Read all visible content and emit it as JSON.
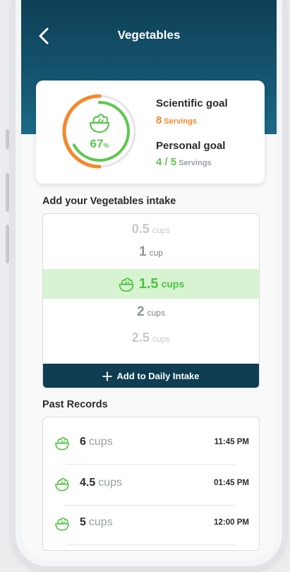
{
  "header": {
    "title": "Vegetables"
  },
  "goal_card": {
    "progress": 0.67,
    "percent_value": "67",
    "percent_sign": "%",
    "scientific_label": "Scientific goal",
    "scientific_value": "8",
    "scientific_unit": "Servings",
    "personal_label": "Personal goal",
    "personal_value": "4 / 5",
    "personal_unit": "Servings"
  },
  "intake": {
    "title": "Add your Vegetables intake",
    "options": [
      {
        "num": "0.5",
        "unit": "cups"
      },
      {
        "num": "1",
        "unit": "cup"
      },
      {
        "num": "1.5",
        "unit": "cups"
      },
      {
        "num": "2",
        "unit": "cups"
      },
      {
        "num": "2.5",
        "unit": "cups"
      }
    ],
    "add_label": "Add to Daily Intake"
  },
  "records": {
    "title": "Past Records",
    "items": [
      {
        "num": "6",
        "unit": "cups",
        "time": "11:45 PM"
      },
      {
        "num": "4.5",
        "unit": "cups",
        "time": "01:45 PM"
      },
      {
        "num": "5",
        "unit": "cups",
        "time": "12:00 PM"
      }
    ]
  },
  "colors": {
    "header": "#15546f",
    "accent_green": "#5cc74f",
    "accent_orange": "#f5882a",
    "button": "#0f3d52"
  },
  "icons": {
    "back": "chevron-left-icon",
    "vegetable": "salad-bowl-icon",
    "add": "plus-icon"
  }
}
